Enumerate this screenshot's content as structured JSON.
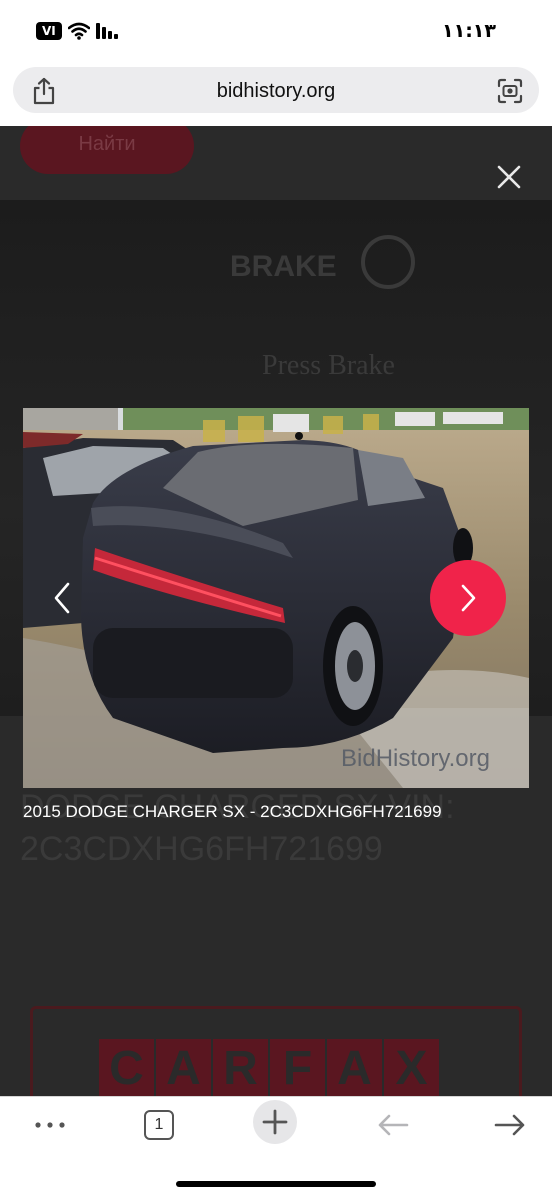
{
  "status_bar": {
    "vpn_label": "VI",
    "time": "١١:١٣"
  },
  "url_bar": {
    "domain": "bidhistory.org"
  },
  "background_page": {
    "search_button_label": "Найти",
    "sign_text_1": "BRAKE",
    "sign_text_2": "Press Brake",
    "title_line_1": "DODGE CHARGER SX VIN:",
    "title_line_2": "2C3CDXHG6FH721699",
    "carfax_letters": [
      "C",
      "A",
      "R",
      "F",
      "A",
      "X"
    ]
  },
  "lightbox": {
    "watermark": "BidHistory.org",
    "caption": "2015 DODGE CHARGER SX - 2C3CDXHG6FH721699"
  },
  "toolbar": {
    "tabs_count": "1"
  },
  "colors": {
    "accent": "#f0234a",
    "overlay": "#2a2a2a"
  }
}
